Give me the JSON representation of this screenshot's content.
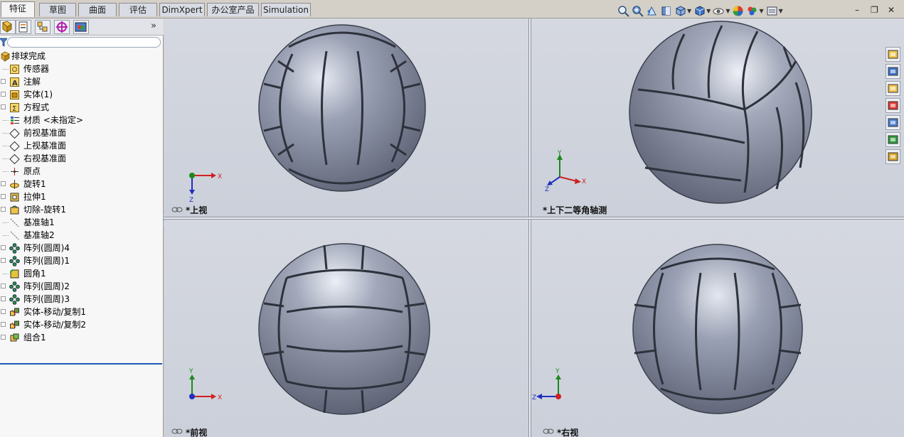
{
  "tabs": [
    {
      "label": "特征",
      "active": true
    },
    {
      "label": "草图",
      "active": false
    },
    {
      "label": "曲面",
      "active": false
    },
    {
      "label": "评估",
      "active": false
    },
    {
      "label": "DimXpert",
      "active": false
    },
    {
      "label": "办公室产品",
      "active": false
    },
    {
      "label": "Simulation",
      "active": false
    }
  ],
  "view_toolbar": {
    "icons": [
      "zoom-to-fit-icon",
      "zoom-area-icon",
      "previous-view-icon",
      "section-view-icon",
      "view-orientation-icon",
      "display-style-icon",
      "hide-show-items-icon",
      "edit-appearance-icon",
      "apply-scene-icon",
      "view-settings-icon"
    ]
  },
  "window_controls": {
    "minimize": "–",
    "restore": "❐",
    "close": "✕"
  },
  "left_panel": {
    "tool_icons": [
      "feature-manager-icon",
      "property-manager-icon",
      "configuration-manager-icon",
      "dimxpert-manager-icon",
      "display-manager-icon"
    ],
    "more_label": "»",
    "filter_icon": "filter-icon",
    "tree": [
      {
        "label": "排球完成",
        "icon": "part-icon",
        "level": 0,
        "expandable": false
      },
      {
        "label": "传感器",
        "icon": "sensor-icon",
        "level": 1,
        "expandable": false
      },
      {
        "label": "注解",
        "icon": "annotation-icon",
        "level": 1,
        "expandable": true
      },
      {
        "label": "实体(1)",
        "icon": "solid-body-icon",
        "level": 1,
        "expandable": true
      },
      {
        "label": "方程式",
        "icon": "equation-icon",
        "level": 1,
        "expandable": true
      },
      {
        "label": "材质 <未指定>",
        "icon": "material-icon",
        "level": 1,
        "expandable": false
      },
      {
        "label": "前视基准面",
        "icon": "plane-icon",
        "level": 1,
        "expandable": false
      },
      {
        "label": "上视基准面",
        "icon": "plane-icon",
        "level": 1,
        "expandable": false
      },
      {
        "label": "右视基准面",
        "icon": "plane-icon",
        "level": 1,
        "expandable": false
      },
      {
        "label": "原点",
        "icon": "origin-icon",
        "level": 1,
        "expandable": false
      },
      {
        "label": "旋转1",
        "icon": "revolve-icon",
        "level": 1,
        "expandable": true
      },
      {
        "label": "拉伸1",
        "icon": "extrude-icon",
        "level": 1,
        "expandable": true
      },
      {
        "label": "切除-旋转1",
        "icon": "cut-revolve-icon",
        "level": 1,
        "expandable": true
      },
      {
        "label": "基准轴1",
        "icon": "axis-icon",
        "level": 1,
        "expandable": false
      },
      {
        "label": "基准轴2",
        "icon": "axis-icon",
        "level": 1,
        "expandable": false
      },
      {
        "label": "阵列(圆周)4",
        "icon": "circular-pattern-icon",
        "level": 1,
        "expandable": true
      },
      {
        "label": "阵列(圆周)1",
        "icon": "circular-pattern-icon",
        "level": 1,
        "expandable": true
      },
      {
        "label": "圆角1",
        "icon": "fillet-icon",
        "level": 1,
        "expandable": false
      },
      {
        "label": "阵列(圆周)2",
        "icon": "circular-pattern-icon",
        "level": 1,
        "expandable": true
      },
      {
        "label": "阵列(圆周)3",
        "icon": "circular-pattern-icon",
        "level": 1,
        "expandable": true
      },
      {
        "label": "实体-移动/复制1",
        "icon": "move-copy-body-icon",
        "level": 1,
        "expandable": true
      },
      {
        "label": "实体-移动/复制2",
        "icon": "move-copy-body-icon",
        "level": 1,
        "expandable": true
      },
      {
        "label": "组合1",
        "icon": "combine-icon",
        "level": 1,
        "expandable": true
      }
    ]
  },
  "viewports": [
    {
      "id": "top",
      "label": "*上视",
      "view": "top"
    },
    {
      "id": "iso",
      "label": "*上下二等角轴测",
      "view": "dimetric"
    },
    {
      "id": "front",
      "label": "*前视",
      "view": "front"
    },
    {
      "id": "right",
      "label": "*右视",
      "view": "right"
    }
  ],
  "triad_labels": {
    "x": "X",
    "y": "Y",
    "z": "Z"
  },
  "task_pane_icons": [
    "solidworks-resources-icon",
    "design-library-icon",
    "file-explorer-icon",
    "search-icon",
    "view-palette-icon",
    "appearances-icon",
    "custom-properties-icon"
  ],
  "colors": {
    "ball": "#8e94a6",
    "viewport_bg": "#d0d4dd",
    "x_axis": "#d02020",
    "y_axis": "#1a8a1a",
    "z_axis": "#2030c0",
    "tree_selection_line": "#1d5ab5"
  }
}
